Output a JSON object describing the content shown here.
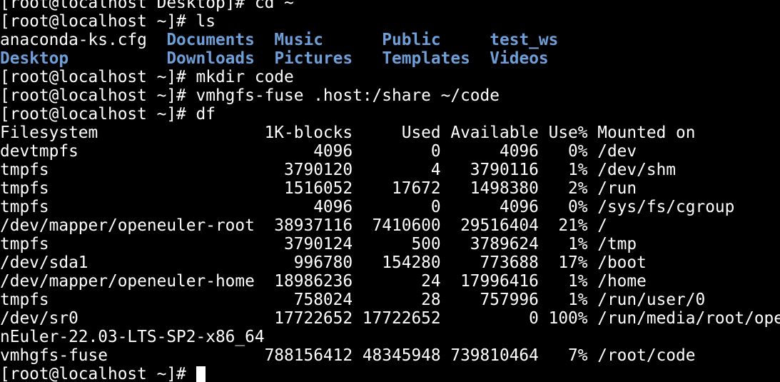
{
  "colors": {
    "background": "#000000",
    "text": "#ffffff",
    "directory": "#6f9fd8",
    "cursor": "#ffffff"
  },
  "terminal": {
    "lines": [
      {
        "segments": [
          {
            "text": "[root@localhost Desktop]# cd ~"
          }
        ]
      },
      {
        "segments": [
          {
            "text": "[root@localhost ~]# ls"
          }
        ]
      },
      {
        "segments": [
          {
            "text": "anaconda-ks.cfg  "
          },
          {
            "text": "Documents",
            "style": "dir"
          },
          {
            "text": "  "
          },
          {
            "text": "Music",
            "style": "dir"
          },
          {
            "text": "      "
          },
          {
            "text": "Public",
            "style": "dir"
          },
          {
            "text": "     "
          },
          {
            "text": "test_ws",
            "style": "dir"
          }
        ]
      },
      {
        "segments": [
          {
            "text": "Desktop",
            "style": "dir"
          },
          {
            "text": "          "
          },
          {
            "text": "Downloads",
            "style": "dir"
          },
          {
            "text": "  "
          },
          {
            "text": "Pictures",
            "style": "dir"
          },
          {
            "text": "   "
          },
          {
            "text": "Templates",
            "style": "dir"
          },
          {
            "text": "  "
          },
          {
            "text": "Videos",
            "style": "dir"
          }
        ]
      },
      {
        "segments": [
          {
            "text": "[root@localhost ~]# mkdir code"
          }
        ]
      },
      {
        "segments": [
          {
            "text": "[root@localhost ~]# vmhgfs-fuse .host:/share ~/code"
          }
        ]
      },
      {
        "segments": [
          {
            "text": "[root@localhost ~]# df"
          }
        ]
      },
      {
        "segments": [
          {
            "text": "Filesystem                 1K-blocks     Used Available Use% Mounted on"
          }
        ]
      },
      {
        "segments": [
          {
            "text": "devtmpfs                        4096        0      4096   0% /dev"
          }
        ]
      },
      {
        "segments": [
          {
            "text": "tmpfs                        3790120        4   3790116   1% /dev/shm"
          }
        ]
      },
      {
        "segments": [
          {
            "text": "tmpfs                        1516052    17672   1498380   2% /run"
          }
        ]
      },
      {
        "segments": [
          {
            "text": "tmpfs                           4096        0      4096   0% /sys/fs/cgroup"
          }
        ]
      },
      {
        "segments": [
          {
            "text": "/dev/mapper/openeuler-root  38937116  7410600  29516404  21% /"
          }
        ]
      },
      {
        "segments": [
          {
            "text": "tmpfs                        3790124      500   3789624   1% /tmp"
          }
        ]
      },
      {
        "segments": [
          {
            "text": "/dev/sda1                     996780   154280    773688  17% /boot"
          }
        ]
      },
      {
        "segments": [
          {
            "text": "/dev/mapper/openeuler-home  18986236       24  17996416   1% /home"
          }
        ]
      },
      {
        "segments": [
          {
            "text": "tmpfs                         758024       28    757996   1% /run/user/0"
          }
        ]
      },
      {
        "segments": [
          {
            "text": "/dev/sr0                    17722652 17722652         0 100% /run/media/root/ope"
          }
        ]
      },
      {
        "segments": [
          {
            "text": "nEuler-22.03-LTS-SP2-x86_64"
          }
        ]
      },
      {
        "segments": [
          {
            "text": "vmhgfs-fuse                788156412 48345948 739810464   7% /root/code"
          }
        ]
      },
      {
        "segments": [
          {
            "text": "[root@localhost ~]# "
          }
        ],
        "cursor": true
      }
    ]
  }
}
